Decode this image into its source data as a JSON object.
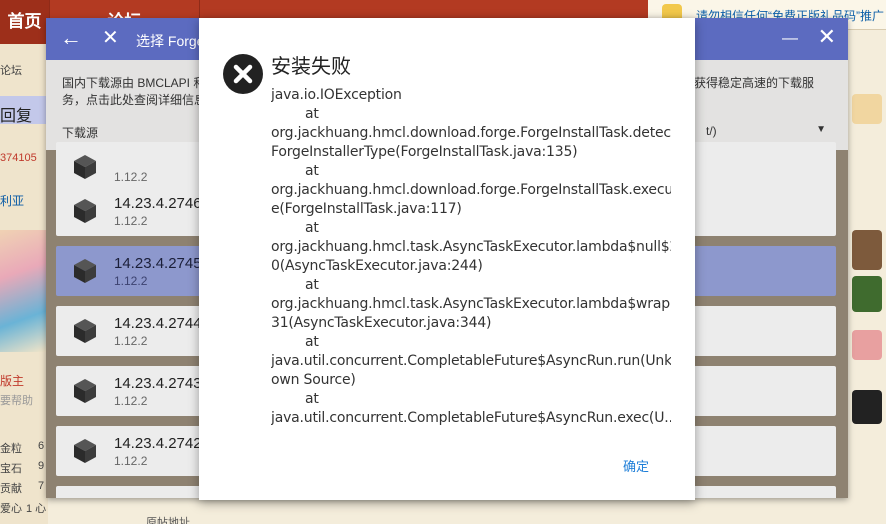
{
  "background_page": {
    "nav_items": [
      "首页",
      "论坛"
    ],
    "notice": "请勿相信任何“免费正版礼品码”推广",
    "left_labels": {
      "forum": "论坛",
      "reply": "回复",
      "uid": "374105",
      "username": "利亚",
      "role": "版主",
      "role_note": "要帮助",
      "stat_gold": "金粒",
      "stat_gold_val": "6",
      "stat_gem": "宝石",
      "stat_gem_val": "9",
      "stat_contrib": "贡献",
      "stat_contrib_val": "7",
      "stat_love": "爱心",
      "stat_love_val": "1 心"
    },
    "bottom_text": "原帖地址"
  },
  "launcher": {
    "title": "选择 Forge",
    "description_line1": "国内下载源由 BMCLAPI 和",
    "description_line2": "务，点击此处查阅详细信息",
    "description_right": "以获得稳定高速的下载服",
    "source_label": "下载源",
    "source_value": "t/)",
    "versions": [
      {
        "version": "",
        "mc": "1.12.2"
      },
      {
        "version": "14.23.4.2746",
        "mc": "1.12.2"
      },
      {
        "version": "14.23.4.2745",
        "mc": "1.12.2"
      },
      {
        "version": "14.23.4.2744",
        "mc": "1.12.2"
      },
      {
        "version": "14.23.4.2743",
        "mc": "1.12.2"
      },
      {
        "version": "14.23.4.2742",
        "mc": "1.12.2"
      },
      {
        "version": "",
        "mc": ""
      }
    ],
    "selected_index": 2
  },
  "dialog": {
    "title": "安装失败",
    "lines": [
      {
        "text": "java.io.IOException",
        "indent": false
      },
      {
        "text": "at",
        "indent": true
      },
      {
        "text": "org.jackhuang.hmcl.download.forge.ForgeInstallTask.detect",
        "indent": false
      },
      {
        "text": "ForgeInstallerType(ForgeInstallTask.java:135)",
        "indent": false
      },
      {
        "text": "at",
        "indent": true
      },
      {
        "text": "org.jackhuang.hmcl.download.forge.ForgeInstallTask.execut",
        "indent": false
      },
      {
        "text": "e(ForgeInstallTask.java:117)",
        "indent": false
      },
      {
        "text": "at",
        "indent": true
      },
      {
        "text": "org.jackhuang.hmcl.task.AsyncTaskExecutor.lambda$null$2",
        "indent": false
      },
      {
        "text": "0(AsyncTaskExecutor.java:244)",
        "indent": false
      },
      {
        "text": "at",
        "indent": true
      },
      {
        "text": "org.jackhuang.hmcl.task.AsyncTaskExecutor.lambda$wrap$",
        "indent": false
      },
      {
        "text": "31(AsyncTaskExecutor.java:344)",
        "indent": false
      },
      {
        "text": "at",
        "indent": true
      },
      {
        "text": "java.util.concurrent.CompletableFuture$AsyncRun.run(Unkn",
        "indent": false
      },
      {
        "text": "own Source)",
        "indent": false
      },
      {
        "text": "at",
        "indent": true
      },
      {
        "text": "java.util.concurrent.CompletableFuture$AsyncRun.exec(U...",
        "indent": false
      }
    ],
    "confirm_label": "确定"
  },
  "colors": {
    "titlebar": "#5c6bc0",
    "selected_item": "#8d98cd",
    "confirm": "#1f7fd8",
    "forum_red": "#b33a22"
  }
}
